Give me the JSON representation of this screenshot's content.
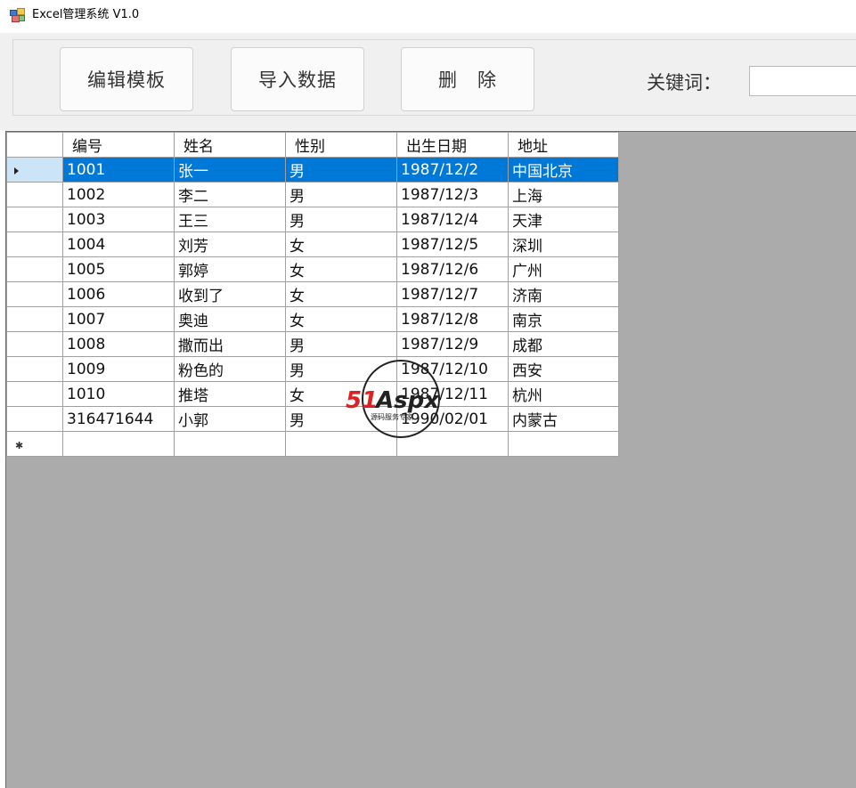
{
  "window": {
    "title": "Excel管理系统 V1.0",
    "icon": "app-window-icon"
  },
  "toolbar": {
    "edit_template_label": "编辑模板",
    "import_data_label": "导入数据",
    "delete_label": "删　除",
    "keyword_label": "关键词：",
    "keyword_value": ""
  },
  "grid": {
    "columns": [
      "编号",
      "姓名",
      "性别",
      "出生日期",
      "地址"
    ],
    "rows": [
      {
        "id": "1001",
        "name": "张一",
        "gender": "男",
        "birth": "1987/12/2",
        "address": "中国北京"
      },
      {
        "id": "1002",
        "name": "李二",
        "gender": "男",
        "birth": "1987/12/3",
        "address": "上海"
      },
      {
        "id": "1003",
        "name": "王三",
        "gender": "男",
        "birth": "1987/12/4",
        "address": "天津"
      },
      {
        "id": "1004",
        "name": "刘芳",
        "gender": "女",
        "birth": "1987/12/5",
        "address": "深圳"
      },
      {
        "id": "1005",
        "name": "郭婷",
        "gender": "女",
        "birth": "1987/12/6",
        "address": "广州"
      },
      {
        "id": "1006",
        "name": "收到了",
        "gender": "女",
        "birth": "1987/12/7",
        "address": "济南"
      },
      {
        "id": "1007",
        "name": "奥迪",
        "gender": "女",
        "birth": "1987/12/8",
        "address": "南京"
      },
      {
        "id": "1008",
        "name": "撒而出",
        "gender": "男",
        "birth": "1987/12/9",
        "address": "成都"
      },
      {
        "id": "1009",
        "name": "粉色的",
        "gender": "男",
        "birth": "1987/12/10",
        "address": "西安"
      },
      {
        "id": "1010",
        "name": "推塔",
        "gender": "女",
        "birth": "1987/12/11",
        "address": "杭州"
      },
      {
        "id": "316471644",
        "name": "小郭",
        "gender": "男",
        "birth": "1990/02/01",
        "address": "内蒙古"
      }
    ],
    "selected_row": 0,
    "selection_color": "#0078d7"
  },
  "watermark": {
    "brand": "51Aspx",
    "tagline": "源码服务专家"
  }
}
